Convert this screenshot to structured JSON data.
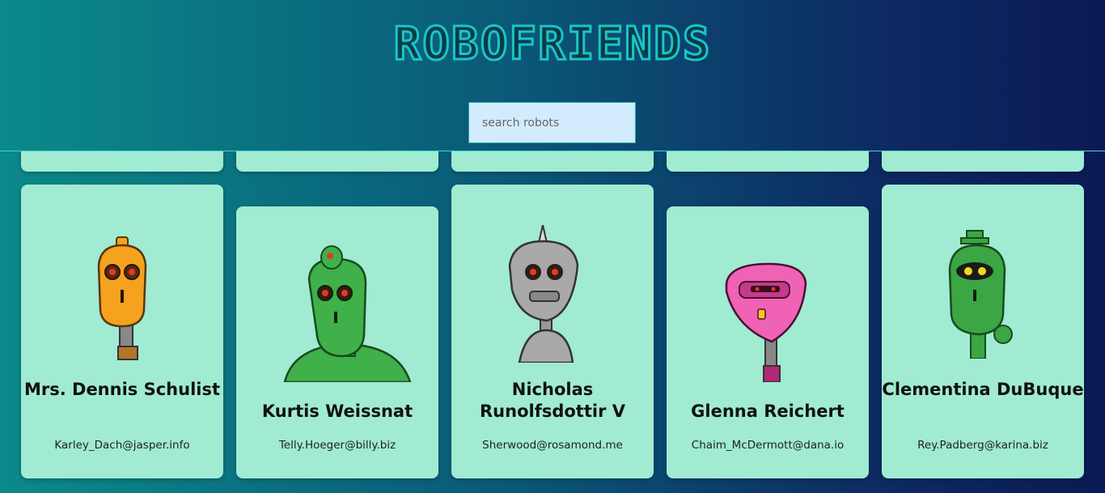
{
  "app": {
    "title": "ROBOFRIENDS"
  },
  "search": {
    "placeholder": "search robots"
  },
  "robots": [
    {
      "name": "Mrs. Dennis Schulist",
      "email": "Karley_Dach@jasper.info",
      "robot_color": "#f5a21e"
    },
    {
      "name": "Kurtis Weissnat",
      "email": "Telly.Hoeger@billy.biz",
      "robot_color": "#3fb04a"
    },
    {
      "name": "Nicholas Runolfsdottir V",
      "email": "Sherwood@rosamond.me",
      "robot_color": "#a9a9ab"
    },
    {
      "name": "Glenna Reichert",
      "email": "Chaim_McDermott@dana.io",
      "robot_color": "#f062b5"
    },
    {
      "name": "Clementina DuBuque",
      "email": "Rey.Padberg@karina.biz",
      "robot_color": "#3aa644"
    }
  ],
  "colors": {
    "card_bg": "#a0ebd2",
    "logo_accent": "#17c6c6",
    "search_bg": "#d2ecfd"
  }
}
